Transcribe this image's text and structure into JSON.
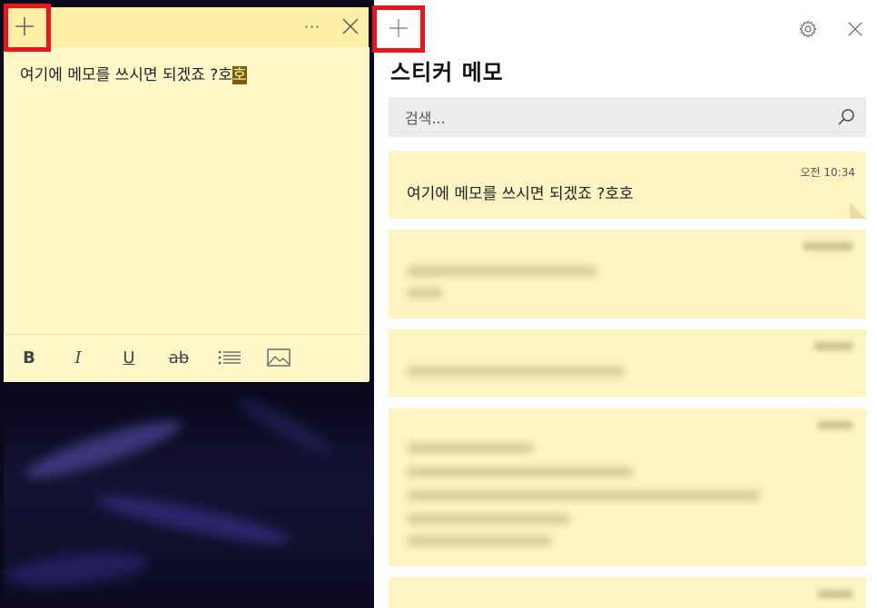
{
  "note": {
    "text_main": "여기에 메모를 쓰시면 되겠죠 ?호",
    "text_highlight": "호",
    "icons": {
      "new": "plus-icon",
      "more": "more-horizontal-icon",
      "close": "close-icon"
    },
    "more_label": "···",
    "toolbar": {
      "bold": "B",
      "italic": "I",
      "underline": "U",
      "strike": "ab"
    }
  },
  "list": {
    "title": "스티커 메모",
    "search_placeholder": "검색...",
    "cards": [
      {
        "time": "오전 10:34",
        "text": "여기에 메모를 쓰시면 되겠죠 ?호호"
      }
    ]
  },
  "colors": {
    "highlight": "#e8161b",
    "note_yellow": "#fef7c7",
    "titlebar_yellow": "#fdf0a6",
    "card_yellow": "#fdf4c2"
  }
}
